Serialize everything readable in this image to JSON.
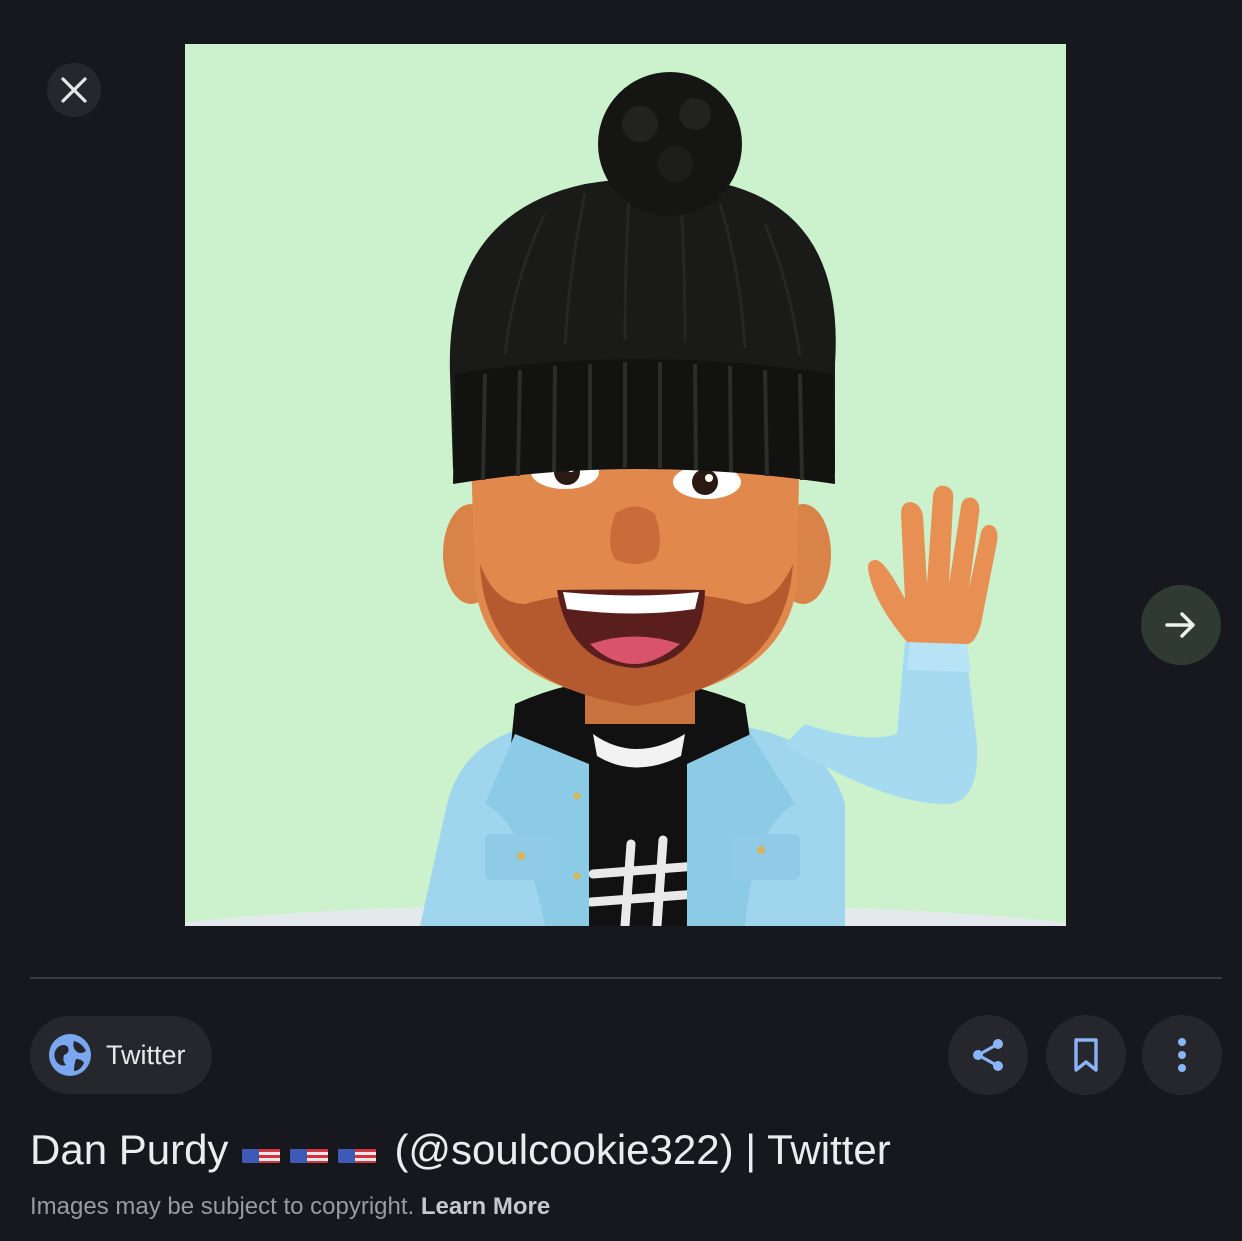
{
  "viewer": {
    "close_icon": "close-icon",
    "next_icon": "arrow-right-icon",
    "image_background": "#cbf2cc"
  },
  "source": {
    "label": "Twitter",
    "icon": "globe-icon"
  },
  "actions": {
    "share_icon": "share-icon",
    "save_icon": "bookmark-icon",
    "more_icon": "more-vert-icon"
  },
  "result": {
    "name": "Dan Purdy",
    "flags": [
      "🇺🇸",
      "🇺🇸",
      "🇺🇸"
    ],
    "handle_suffix": "(@soulcookie322) | Twitter"
  },
  "copyright": {
    "text": "Images may be subject to copyright.",
    "link": "Learn More"
  }
}
